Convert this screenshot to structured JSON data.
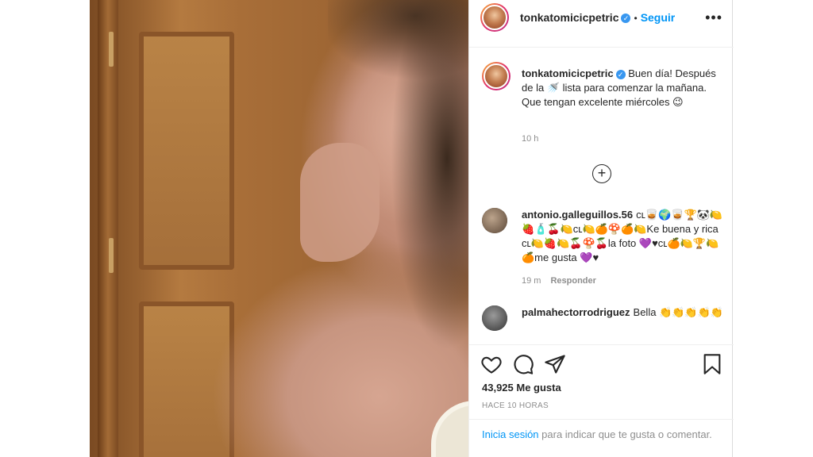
{
  "post": {
    "username": "tonkatomicicpetric",
    "follow_label": "Seguir",
    "dot": "•",
    "more_icon": "•••",
    "caption": "Buen día! Después de la 🚿 lista para comenzar la mañana. Que tengan excelente miércoles 😉",
    "caption_time": "10 h",
    "load_more_icon": "+"
  },
  "comments": [
    {
      "username": "antonio.galleguillos.56",
      "text": "ᴄʟ🥃🌍🥃🏆🐼🍋🍓🧴🍒🍋ᴄʟ🍋🍊🍄🍊🍋Ke buena y rica ᴄʟ🍋🍓🍋🍒🍄🍒la foto 💜♥ᴄʟ🍊🍋🏆🍋🍊me gusta 💜♥",
      "time": "19 m",
      "reply_label": "Responder"
    },
    {
      "username": "palmahectorrodriguez",
      "text": "Bella 👏👏👏👏👏"
    }
  ],
  "stats": {
    "likes": "43,925 Me gusta",
    "posted": "HACE 10 HORAS"
  },
  "login": {
    "link": "Inicia sesión",
    "rest": " para indicar que te gusta o comentar."
  },
  "colors": {
    "link_blue": "#0095f6",
    "verified_blue": "#3897f0"
  },
  "icons": [
    "heart-icon",
    "comment-icon",
    "share-icon",
    "bookmark-icon",
    "verified-icon",
    "plus-circle-icon"
  ]
}
